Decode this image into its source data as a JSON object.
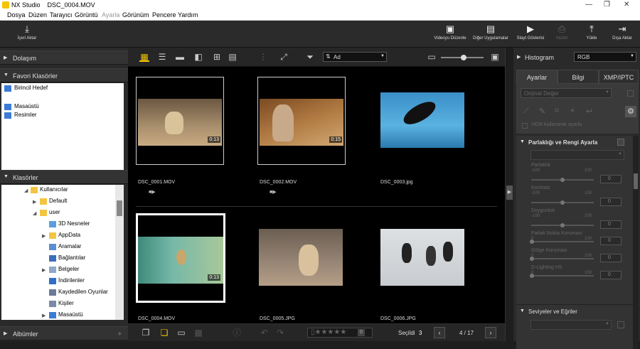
{
  "window": {
    "app_name": "NX Studio",
    "file_title": "DSC_0004.MOV"
  },
  "menu": [
    "Dosya",
    "Düzen",
    "Tarayıcı",
    "Görüntü",
    "Ayarla",
    "Görünüm",
    "Pencere",
    "Yardım"
  ],
  "toolbar": {
    "import": "İçeri Aktar",
    "movie_editor": "Videoyu Düzenle",
    "other_apps": "Diğer Uygulamalar",
    "slideshow": "Slayt Gösterisi",
    "print": "Yazdır",
    "upload": "Yükle",
    "export": "Dışa Aktar"
  },
  "left": {
    "navigation": "Dolaşım",
    "favorites_title": "Favori Klasörler",
    "favorites": [
      "Birincil Hedef",
      "Masaüstü",
      "Resimler"
    ],
    "folders_title": "Klasörler",
    "tree": [
      "Kullanıcılar",
      "Default",
      "user",
      "3D Nesneler",
      "AppData",
      "Aramalar",
      "Bağlantılar",
      "Belgeler",
      "İndirilenler",
      "Kaydedilen Oyunlar",
      "Kişiler",
      "Masaüstü"
    ],
    "albums_title": "Albümler"
  },
  "center": {
    "sort_label": "Ad",
    "thumbnails": [
      {
        "name": "DSC_0001.MOV",
        "duration": "0:13",
        "video": true
      },
      {
        "name": "DSC_0002.MOV",
        "duration": "0:15",
        "video": true
      },
      {
        "name": "DSC_0003.jpg",
        "duration": "",
        "video": false
      },
      {
        "name": "DSC_0004.MOV",
        "duration": "0:13",
        "video": true
      },
      {
        "name": "DSC_0005.JPG",
        "duration": "",
        "video": false
      },
      {
        "name": "DSC_0006.JPG",
        "duration": "",
        "video": false
      }
    ],
    "selected_label": "Seçildi",
    "selected_count": "3",
    "page_indicator": "4 / 17",
    "rating_zero": "0"
  },
  "right": {
    "histogram_label": "Histogram",
    "histogram_channel": "RGB",
    "tabs": [
      "Ayarlar",
      "Bilgi",
      "XMP/IPTC"
    ],
    "original_value": "Orijinal Değer",
    "hdr_label": "HDR kullanarak ayarla",
    "section_title": "Parlaklığı ve Rengi Ayarla",
    "sliders": [
      {
        "label": "Parlaklık",
        "min": "-100",
        "max": "100",
        "value": "0"
      },
      {
        "label": "Kontrast",
        "min": "-100",
        "max": "100",
        "value": "0"
      },
      {
        "label": "Doygunluk",
        "min": "-100",
        "max": "100",
        "value": "0"
      },
      {
        "label": "Parlak Nokta Koruması",
        "min": "0",
        "max": "100",
        "value": "0"
      },
      {
        "label": "Gölge Koruması",
        "min": "0",
        "max": "100",
        "value": "0"
      },
      {
        "label": "D-Lighting HS",
        "min": "0",
        "max": "100",
        "value": "0"
      }
    ],
    "levels_title": "Seviyeler ve Eğriler"
  }
}
